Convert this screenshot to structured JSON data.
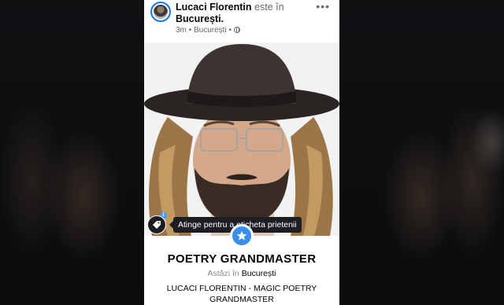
{
  "post": {
    "author": "Lucaci Florentin",
    "checkin_verb": "este în",
    "location": "București.",
    "time": "3m",
    "meta_location": "București",
    "separator": "•",
    "privacy_icon": "globe-icon",
    "more_icon": "more-options-icon"
  },
  "photo": {
    "tag_badge_count": "1",
    "tag_tooltip": "Atinge pentru a eticheta prietenii",
    "tag_icon": "tag-icon",
    "pin_icon": "star-pin-icon"
  },
  "checkin_card": {
    "place_name": "POETRY GRANDMASTER",
    "date_prefix": "Astăzi în",
    "city": "București",
    "caption": "LUCACI FLORENTIN - MAGIC POETRY GRANDMASTER"
  },
  "colors": {
    "accent": "#1877f2",
    "pin": "#3b8ee8",
    "tooltip_bg": "#1c1e21"
  }
}
